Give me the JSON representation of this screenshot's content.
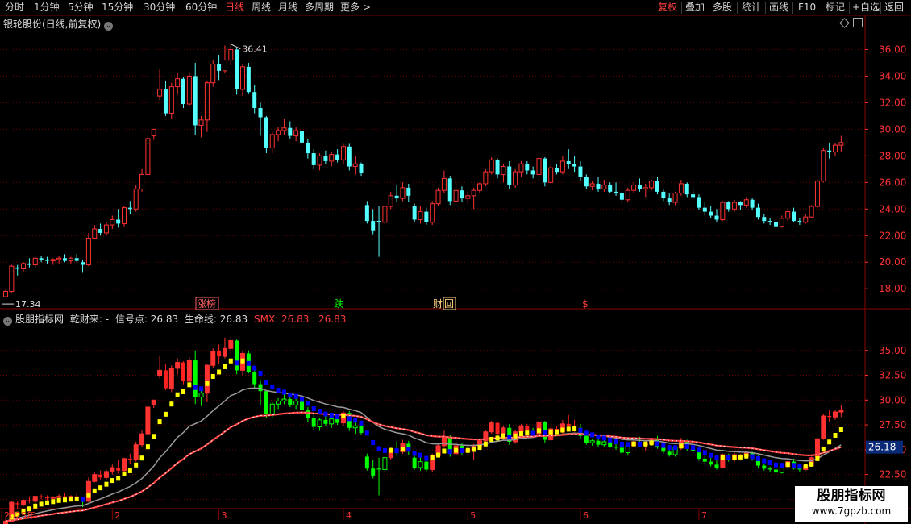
{
  "toolbar": {
    "periods": [
      "分时",
      "1分钟",
      "5分钟",
      "15分钟",
      "30分钟",
      "60分钟",
      "日线",
      "周线",
      "月线",
      "多周期",
      "更多 >"
    ],
    "active_period": "日线",
    "actions": [
      "复权",
      "叠加",
      "多股",
      "统计",
      "画线",
      "F10",
      "标记",
      "+自选",
      "返回"
    ]
  },
  "main_chart": {
    "title": "银轮股份(日线,前复权)",
    "y_ticks": [
      "36.00",
      "34.00",
      "32.00",
      "30.00",
      "28.00",
      "26.00",
      "24.00",
      "22.00",
      "20.00",
      "18.00"
    ],
    "high_label": "36.41",
    "low_label": "17.34",
    "event_labels": [
      "涨榜",
      "跌",
      "财",
      "回",
      "$"
    ]
  },
  "sub_chart": {
    "indicator_name": "股朋指标网",
    "label_qcl": "乾财来: -",
    "label_signal": "信号点: 26.83",
    "label_life": "生命线: 26.83",
    "label_smx": "SMX: 26.83 : 26.83",
    "y_ticks": [
      "35.00",
      "32.50",
      "30.00",
      "27.50",
      "25.00",
      "22.50",
      "20.00"
    ],
    "price_tag": "26.18"
  },
  "x_axis": {
    "labels": [
      "2025年",
      "2",
      "3",
      "4",
      "5",
      "6",
      "7"
    ]
  },
  "watermark": {
    "line1": "股朋指标网",
    "line2": "www.7gpzb.com"
  },
  "colors": {
    "up": "#ff3232",
    "down": "#54ffff",
    "grid": "#6e0000",
    "axis_text": "#ff3232",
    "signal_up": "#ffff00",
    "signal_down": "#0000ff",
    "green_bar": "#00ff00",
    "life_line": "#ff4040",
    "smx_line": "#9a9a9a"
  },
  "chart_data": {
    "type": "candlestick",
    "title": "",
    "x": [
      "2025-01-02",
      "2025-01-03",
      "2025-01-06",
      "2025-01-07",
      "2025-01-08",
      "2025-01-09",
      "2025-01-10",
      "2025-01-13",
      "2025-01-14",
      "2025-01-15",
      "2025-01-16",
      "2025-01-17",
      "2025-01-20",
      "2025-01-21",
      "2025-01-22",
      "2025-01-23",
      "2025-01-24",
      "2025-01-27",
      "2025-02-05",
      "2025-02-06",
      "2025-02-07",
      "2025-02-10",
      "2025-02-11",
      "2025-02-12",
      "2025-02-13",
      "2025-02-14",
      "2025-02-17",
      "2025-02-18",
      "2025-02-19",
      "2025-02-20",
      "2025-02-21",
      "2025-02-24",
      "2025-02-25",
      "2025-02-26",
      "2025-02-27",
      "2025-02-28",
      "2025-03-03",
      "2025-03-04",
      "2025-03-05",
      "2025-03-06",
      "2025-03-07",
      "2025-03-10",
      "2025-03-11",
      "2025-03-12",
      "2025-03-13",
      "2025-03-14",
      "2025-03-17",
      "2025-03-18",
      "2025-03-19",
      "2025-03-20",
      "2025-03-21",
      "2025-03-24",
      "2025-03-25",
      "2025-03-26",
      "2025-03-27",
      "2025-03-28",
      "2025-03-31",
      "2025-04-01",
      "2025-04-02",
      "2025-04-03",
      "2025-04-07",
      "2025-04-08",
      "2025-04-09",
      "2025-04-10",
      "2025-04-11",
      "2025-04-14",
      "2025-04-15",
      "2025-04-16",
      "2025-04-17",
      "2025-04-18",
      "2025-04-21",
      "2025-04-22",
      "2025-04-23",
      "2025-04-24",
      "2025-04-25",
      "2025-04-28",
      "2025-04-29",
      "2025-04-30",
      "2025-05-06",
      "2025-05-07",
      "2025-05-08",
      "2025-05-09",
      "2025-05-12",
      "2025-05-13",
      "2025-05-14",
      "2025-05-15",
      "2025-05-16",
      "2025-05-19",
      "2025-05-20",
      "2025-05-21",
      "2025-05-22",
      "2025-05-23",
      "2025-05-26",
      "2025-05-27",
      "2025-05-28",
      "2025-05-29",
      "2025-05-30",
      "2025-06-03",
      "2025-06-04",
      "2025-06-05",
      "2025-06-06",
      "2025-06-09",
      "2025-06-10",
      "2025-06-11",
      "2025-06-12",
      "2025-06-13",
      "2025-06-16",
      "2025-06-17",
      "2025-06-18",
      "2025-06-19",
      "2025-06-20",
      "2025-06-23",
      "2025-06-24",
      "2025-06-25",
      "2025-06-26",
      "2025-06-27",
      "2025-06-30",
      "2025-07-01",
      "2025-07-02",
      "2025-07-03",
      "2025-07-04",
      "2025-07-07",
      "2025-07-08",
      "2025-07-09",
      "2025-07-10",
      "2025-07-11",
      "2025-07-14",
      "2025-07-15",
      "2025-07-16",
      "2025-07-17",
      "2025-07-18",
      "2025-07-21",
      "2025-07-22",
      "2025-07-23",
      "2025-07-24",
      "2025-07-25",
      "2025-07-28",
      "2025-07-29",
      "2025-07-30",
      "2025-07-31",
      "2025-08-01",
      "2025-08-04",
      "2025-08-05",
      "2025-08-06",
      "2025-08-07",
      "2025-08-08",
      "2025-08-11"
    ],
    "series": [
      {
        "name": "",
        "ohlc": [
          [
            17.4,
            18.0,
            17.34,
            17.8
          ],
          [
            17.8,
            19.8,
            17.7,
            19.7
          ],
          [
            19.6,
            19.8,
            19.0,
            19.5
          ],
          [
            19.5,
            20.0,
            19.3,
            19.9
          ],
          [
            19.9,
            20.3,
            19.6,
            19.8
          ],
          [
            19.8,
            20.4,
            19.6,
            20.3
          ],
          [
            20.3,
            20.5,
            20.0,
            20.2
          ],
          [
            20.2,
            20.4,
            19.9,
            20.1
          ],
          [
            20.1,
            20.3,
            19.8,
            20.2
          ],
          [
            20.2,
            20.5,
            19.9,
            20.3
          ],
          [
            20.3,
            20.6,
            20.0,
            20.1
          ],
          [
            20.1,
            20.4,
            19.9,
            20.3
          ],
          [
            20.3,
            20.6,
            20.0,
            20.1
          ],
          [
            20.0,
            20.2,
            19.2,
            19.8
          ],
          [
            19.8,
            22.2,
            19.7,
            21.8
          ],
          [
            21.8,
            22.8,
            21.7,
            22.5
          ],
          [
            22.5,
            22.9,
            22.0,
            22.2
          ],
          [
            22.2,
            23.0,
            22.0,
            22.8
          ],
          [
            22.8,
            23.5,
            22.5,
            23.2
          ],
          [
            23.2,
            24.0,
            22.6,
            22.9
          ],
          [
            22.9,
            24.2,
            22.7,
            24.1
          ],
          [
            24.1,
            24.6,
            23.6,
            24.0
          ],
          [
            24.0,
            25.8,
            23.8,
            25.5
          ],
          [
            25.5,
            27.0,
            25.3,
            26.6
          ],
          [
            26.6,
            29.5,
            26.5,
            29.3
          ],
          [
            29.5,
            30.0,
            29.2,
            30.0
          ],
          [
            32.5,
            34.5,
            32.2,
            33.0
          ],
          [
            33.0,
            33.6,
            31.0,
            31.2
          ],
          [
            31.2,
            33.5,
            30.8,
            33.2
          ],
          [
            33.2,
            34.2,
            32.6,
            33.8
          ],
          [
            33.8,
            33.9,
            31.6,
            31.9
          ],
          [
            31.9,
            34.3,
            31.7,
            34.0
          ],
          [
            34.0,
            35.0,
            29.6,
            30.3
          ],
          [
            30.3,
            31.0,
            29.4,
            30.7
          ],
          [
            30.7,
            33.6,
            29.8,
            33.5
          ],
          [
            33.5,
            35.2,
            33.2,
            34.9
          ],
          [
            34.9,
            35.6,
            33.7,
            34.4
          ],
          [
            34.4,
            36.3,
            34.2,
            35.2
          ],
          [
            35.2,
            36.41,
            34.8,
            36.0
          ],
          [
            36.0,
            36.1,
            32.6,
            33.0
          ],
          [
            33.0,
            34.9,
            32.5,
            34.7
          ],
          [
            34.7,
            35.0,
            32.7,
            32.8
          ],
          [
            32.8,
            33.3,
            31.2,
            31.6
          ],
          [
            31.6,
            32.0,
            29.5,
            30.9
          ],
          [
            30.9,
            31.0,
            28.2,
            28.6
          ],
          [
            28.6,
            29.8,
            28.2,
            29.6
          ],
          [
            29.6,
            30.2,
            29.1,
            29.9
          ],
          [
            29.9,
            30.8,
            29.6,
            30.1
          ],
          [
            30.1,
            30.6,
            29.3,
            29.5
          ],
          [
            29.5,
            30.2,
            29.1,
            29.9
          ],
          [
            29.9,
            30.0,
            28.8,
            29.0
          ],
          [
            29.0,
            29.3,
            27.8,
            28.2
          ],
          [
            28.2,
            28.5,
            27.0,
            27.3
          ],
          [
            27.3,
            28.2,
            26.9,
            28.0
          ],
          [
            28.0,
            28.4,
            27.4,
            27.6
          ],
          [
            27.6,
            28.3,
            27.2,
            28.1
          ],
          [
            28.1,
            28.5,
            27.5,
            27.7
          ],
          [
            27.7,
            28.9,
            27.4,
            28.7
          ],
          [
            28.7,
            28.9,
            26.9,
            27.2
          ],
          [
            27.2,
            28.0,
            26.6,
            27.4
          ],
          [
            27.4,
            27.5,
            26.5,
            26.7
          ],
          [
            24.3,
            24.6,
            22.9,
            23.1
          ],
          [
            23.1,
            24.0,
            22.1,
            22.4
          ],
          [
            23.1,
            24.2,
            20.4,
            23.0
          ],
          [
            23.0,
            24.3,
            22.8,
            24.2
          ],
          [
            24.2,
            25.3,
            24.0,
            25.0
          ],
          [
            25.0,
            25.8,
            24.5,
            24.8
          ],
          [
            24.8,
            26.0,
            24.6,
            25.6
          ],
          [
            25.6,
            25.9,
            24.5,
            25.0
          ],
          [
            24.2,
            24.4,
            23.0,
            23.2
          ],
          [
            23.2,
            24.2,
            22.9,
            23.8
          ],
          [
            23.8,
            24.1,
            22.8,
            23.0
          ],
          [
            23.0,
            24.6,
            22.8,
            24.4
          ],
          [
            24.4,
            25.6,
            24.2,
            25.4
          ],
          [
            25.4,
            26.9,
            25.2,
            26.3
          ],
          [
            26.3,
            26.5,
            24.3,
            24.6
          ],
          [
            24.6,
            26.0,
            24.5,
            25.4
          ],
          [
            25.4,
            25.7,
            24.5,
            24.8
          ],
          [
            24.8,
            25.3,
            24.4,
            25.0
          ],
          [
            25.0,
            25.6,
            24.0,
            25.4
          ],
          [
            25.4,
            26.0,
            25.2,
            25.9
          ],
          [
            25.9,
            27.0,
            25.7,
            26.8
          ],
          [
            26.8,
            27.9,
            26.6,
            27.7
          ],
          [
            27.7,
            27.8,
            26.3,
            26.6
          ],
          [
            26.6,
            27.4,
            26.0,
            27.2
          ],
          [
            27.2,
            27.6,
            25.5,
            25.8
          ],
          [
            25.8,
            27.0,
            25.6,
            26.8
          ],
          [
            26.8,
            27.6,
            26.4,
            27.4
          ],
          [
            27.4,
            27.6,
            26.6,
            26.9
          ],
          [
            26.9,
            27.2,
            26.3,
            26.6
          ],
          [
            26.6,
            28.0,
            26.4,
            27.8
          ],
          [
            27.8,
            27.9,
            25.7,
            26.0
          ],
          [
            26.0,
            27.3,
            25.9,
            27.1
          ],
          [
            27.1,
            27.4,
            26.6,
            26.8
          ],
          [
            26.8,
            28.0,
            26.6,
            27.6
          ],
          [
            27.6,
            28.5,
            27.0,
            27.4
          ],
          [
            27.4,
            28.0,
            26.8,
            27.2
          ],
          [
            27.2,
            27.6,
            26.1,
            26.4
          ],
          [
            26.4,
            26.6,
            25.5,
            25.7
          ],
          [
            25.7,
            26.1,
            25.4,
            25.9
          ],
          [
            25.9,
            26.4,
            25.3,
            25.5
          ],
          [
            25.5,
            26.2,
            25.3,
            25.8
          ],
          [
            25.8,
            26.0,
            25.2,
            25.3
          ],
          [
            25.3,
            26.0,
            25.0,
            25.2
          ],
          [
            25.2,
            25.3,
            24.4,
            24.7
          ],
          [
            24.7,
            25.6,
            24.5,
            25.4
          ],
          [
            25.4,
            26.0,
            25.2,
            25.8
          ],
          [
            25.8,
            26.3,
            25.3,
            25.5
          ],
          [
            25.5,
            25.9,
            24.9,
            25.6
          ],
          [
            25.6,
            26.2,
            25.4,
            26.1
          ],
          [
            26.1,
            26.4,
            25.1,
            25.3
          ],
          [
            25.3,
            25.5,
            24.6,
            24.8
          ],
          [
            24.8,
            25.2,
            24.3,
            24.5
          ],
          [
            24.5,
            25.3,
            24.3,
            25.2
          ],
          [
            25.2,
            26.2,
            25.0,
            25.9
          ],
          [
            25.9,
            26.0,
            24.9,
            25.1
          ],
          [
            25.1,
            25.6,
            24.7,
            24.9
          ],
          [
            24.9,
            25.1,
            23.9,
            24.1
          ],
          [
            24.1,
            24.5,
            23.5,
            23.8
          ],
          [
            23.8,
            24.2,
            23.3,
            23.5
          ],
          [
            23.5,
            24.0,
            23.0,
            23.2
          ],
          [
            23.2,
            24.6,
            23.1,
            24.5
          ],
          [
            24.5,
            24.6,
            23.8,
            24.0
          ],
          [
            24.0,
            24.7,
            23.8,
            24.5
          ],
          [
            24.5,
            24.6,
            23.9,
            24.3
          ],
          [
            24.3,
            24.9,
            24.1,
            24.7
          ],
          [
            24.7,
            24.8,
            23.9,
            24.1
          ],
          [
            24.1,
            24.4,
            23.2,
            23.4
          ],
          [
            23.4,
            23.6,
            22.9,
            23.1
          ],
          [
            23.1,
            23.3,
            22.8,
            23.0
          ],
          [
            23.0,
            23.4,
            22.5,
            22.7
          ],
          [
            22.7,
            23.5,
            22.6,
            23.3
          ],
          [
            23.3,
            24.0,
            23.1,
            23.8
          ],
          [
            23.8,
            24.1,
            23.0,
            23.1
          ],
          [
            23.1,
            23.3,
            22.8,
            23.0
          ],
          [
            23.0,
            23.6,
            22.9,
            23.4
          ],
          [
            23.4,
            24.3,
            23.3,
            24.2
          ],
          [
            24.2,
            26.2,
            24.1,
            26.1
          ],
          [
            26.1,
            28.6,
            26.0,
            28.4
          ],
          [
            28.4,
            29.0,
            27.8,
            28.3
          ],
          [
            28.3,
            29.0,
            28.0,
            28.8
          ],
          [
            28.8,
            29.5,
            28.3,
            29.0
          ]
        ]
      }
    ],
    "ylim": [
      16.8,
      37.3
    ],
    "sub_ylim": [
      19.3,
      37.5
    ]
  }
}
